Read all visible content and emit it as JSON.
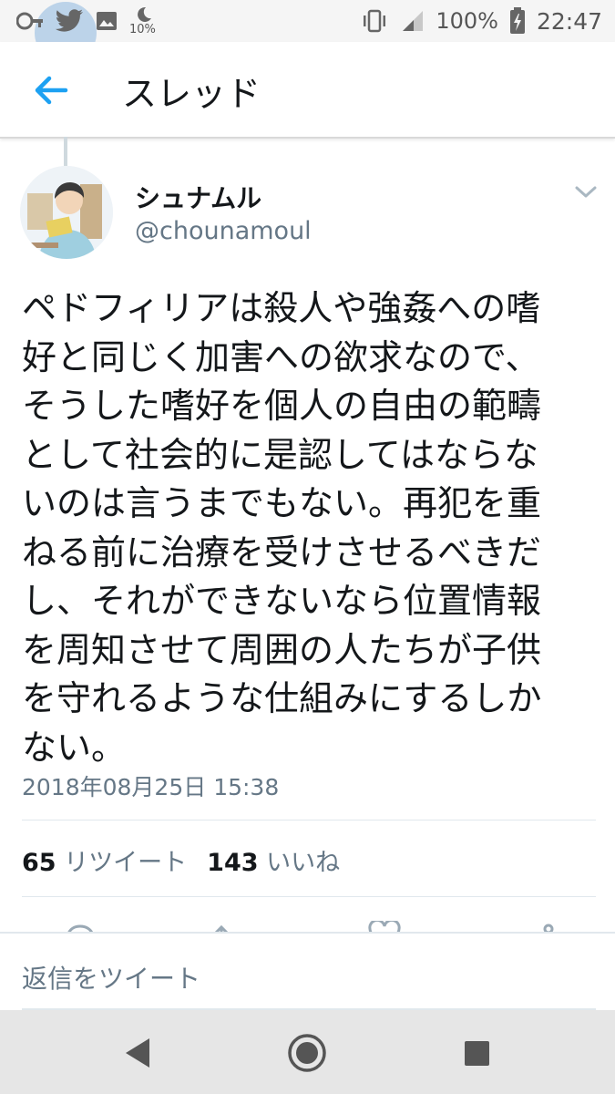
{
  "status_bar": {
    "notification_icons": [
      "key-icon",
      "twitter-icon",
      "image-icon",
      "moon-icon"
    ],
    "moon_label": "10%",
    "battery_percent": "100%",
    "time": "22:47"
  },
  "app_bar": {
    "back_icon": "arrow-left-icon",
    "title": "スレッド",
    "accent_color": "#1da1f2"
  },
  "tweet": {
    "display_name": "シュナムル",
    "handle": "@chounamoul",
    "text": "ペドフィリアは殺人や強姦への嗜\n好と同じく加害への欲求なので、\nそうした嗜好を個人の自由の範疇\nとして社会的に是認してはならな\nいのは言うまでもない。再犯を重\nねる前に治療を受けさせるべきだ\nし、それができないなら位置情報\nを周知させて周囲の人たちが子供\nを守れるような仕組みにするしか\nない。",
    "timestamp": "2018年08月25日 15:38",
    "retweet_count": "65",
    "retweet_label": "リツイート",
    "like_count": "143",
    "like_label": "いいね"
  },
  "reply": {
    "placeholder": "返信をツイート"
  },
  "nav_bar": {
    "buttons": [
      "back-triangle-icon",
      "home-circle-icon",
      "recents-square-icon"
    ]
  }
}
